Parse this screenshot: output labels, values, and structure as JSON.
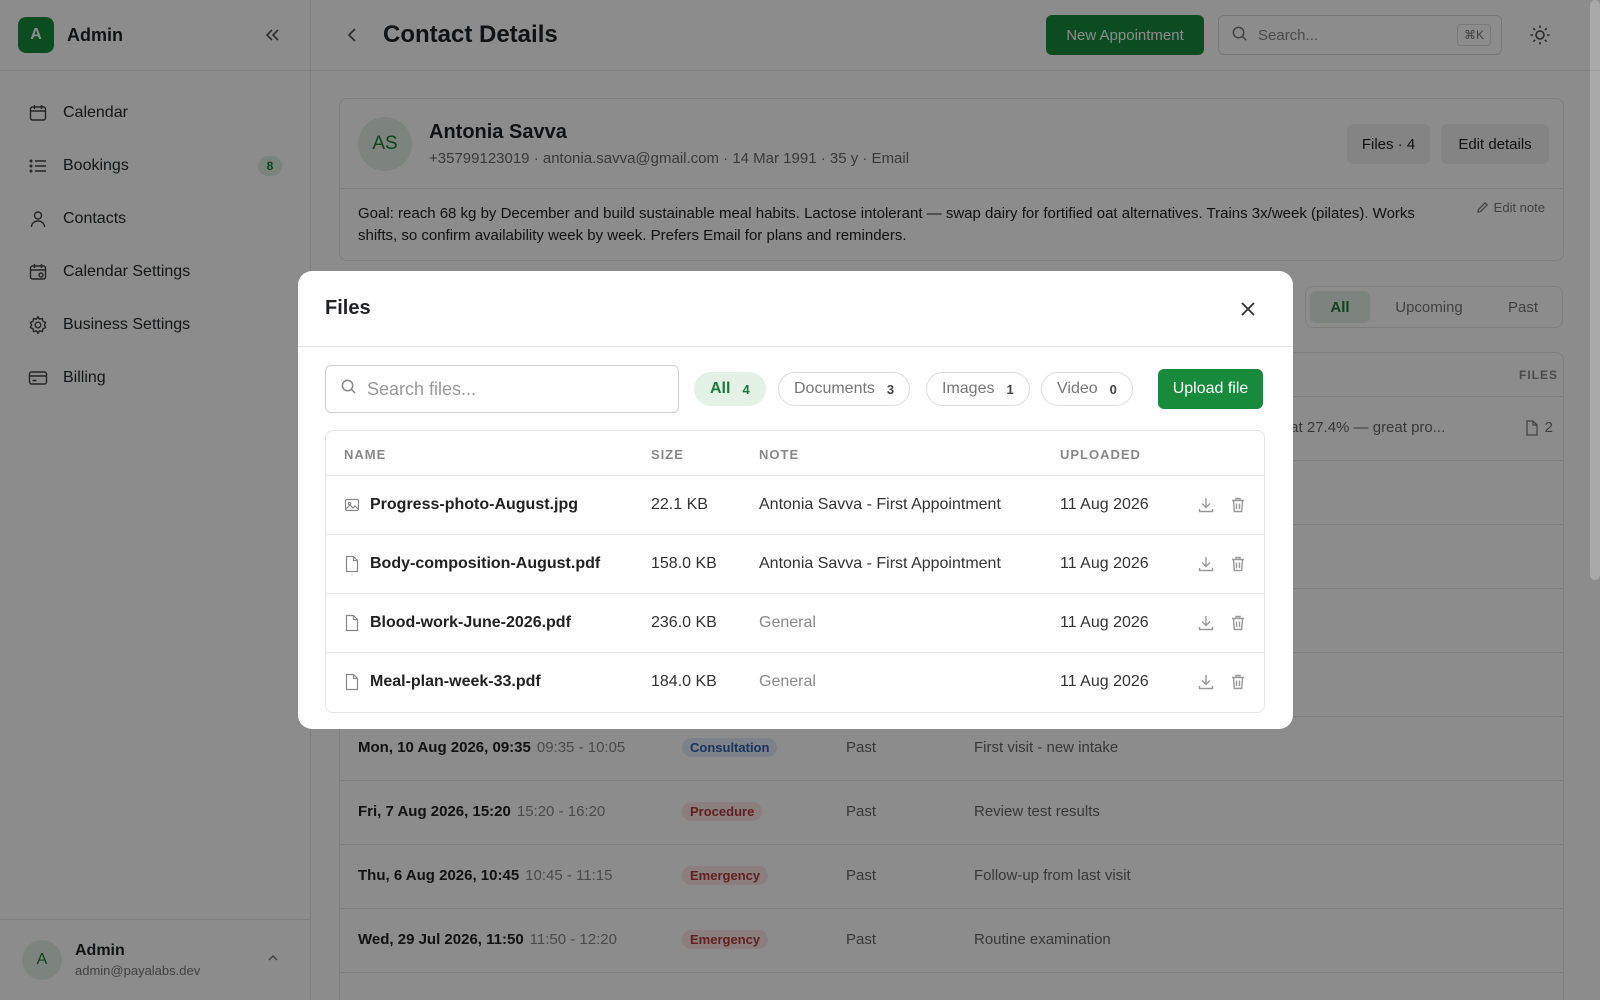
{
  "sidebar": {
    "logo_letter": "A",
    "title": "Admin",
    "items": [
      {
        "label": "Calendar",
        "icon": "calendar-icon"
      },
      {
        "label": "Bookings",
        "icon": "list-icon",
        "badge": "8"
      },
      {
        "label": "Contacts",
        "icon": "user-icon"
      },
      {
        "label": "Calendar Settings",
        "icon": "calendar-settings-icon"
      },
      {
        "label": "Business Settings",
        "icon": "gear-icon"
      },
      {
        "label": "Billing",
        "icon": "credit-card-icon"
      }
    ],
    "footer": {
      "avatar": "A",
      "name": "Admin",
      "email": "admin@payalabs.dev"
    }
  },
  "header": {
    "title": "Contact Details",
    "new_appointment": "New Appointment",
    "search_placeholder": "Search...",
    "shortcut": "⌘K"
  },
  "contact": {
    "initials": "AS",
    "name": "Antonia Savva",
    "meta": "+35799123019 · antonia.savva@gmail.com · 14 Mar 1991 · 35 y · Email",
    "files_button": "Files · 4",
    "edit_button": "Edit details",
    "note": "Goal: reach 68 kg by December and build sustainable meal habits. Lactose intolerant — swap dairy for fortified oat alternatives. Trains 3x/week (pilates). Works shifts, so confirm availability week by week. Prefers Email for plans and reminders.",
    "edit_note": "Edit note"
  },
  "booking_filter": {
    "all": "All",
    "upcoming": "Upcoming",
    "past": "Past"
  },
  "bookings": {
    "files_header": "FILES",
    "first_row_note": "dy fat 27.4% — great pro...",
    "first_row_files": "2",
    "rows": [
      {
        "date": "Mon, 10 Aug 2026, 09:35",
        "time": "09:35 - 10:05",
        "type": "Consultation",
        "status": "Past",
        "note": "First visit - new intake"
      },
      {
        "date": "Fri, 7 Aug 2026, 15:20",
        "time": "15:20 - 16:20",
        "type": "Procedure",
        "status": "Past",
        "note": "Review test results"
      },
      {
        "date": "Thu, 6 Aug 2026, 10:45",
        "time": "10:45 - 11:15",
        "type": "Emergency",
        "status": "Past",
        "note": "Follow-up from last visit"
      },
      {
        "date": "Wed, 29 Jul 2026, 11:50",
        "time": "11:50 - 12:20",
        "type": "Emergency",
        "status": "Past",
        "note": "Routine examination"
      }
    ]
  },
  "modal": {
    "title": "Files",
    "search_placeholder": "Search files...",
    "filters": [
      {
        "label": "All",
        "count": "4"
      },
      {
        "label": "Documents",
        "count": "3"
      },
      {
        "label": "Images",
        "count": "1"
      },
      {
        "label": "Video",
        "count": "0"
      }
    ],
    "upload": "Upload file",
    "columns": {
      "name": "NAME",
      "size": "SIZE",
      "note": "NOTE",
      "uploaded": "UPLOADED"
    },
    "files": [
      {
        "name": "Progress-photo-August.jpg",
        "size": "22.1 KB",
        "note": "Antonia Savva - First Appointment",
        "uploaded": "11 Aug 2026",
        "kind": "image-icon"
      },
      {
        "name": "Body-composition-August.pdf",
        "size": "158.0 KB",
        "note": "Antonia Savva - First Appointment",
        "uploaded": "11 Aug 2026",
        "kind": "document-icon"
      },
      {
        "name": "Blood-work-June-2026.pdf",
        "size": "236.0 KB",
        "note": "General",
        "uploaded": "11 Aug 2026",
        "kind": "document-icon"
      },
      {
        "name": "Meal-plan-week-33.pdf",
        "size": "184.0 KB",
        "note": "General",
        "uploaded": "11 Aug 2026",
        "kind": "document-icon"
      }
    ]
  },
  "colors": {
    "brand": "#178a3c",
    "overlay": "rgba(0,0,0,0.45)"
  }
}
